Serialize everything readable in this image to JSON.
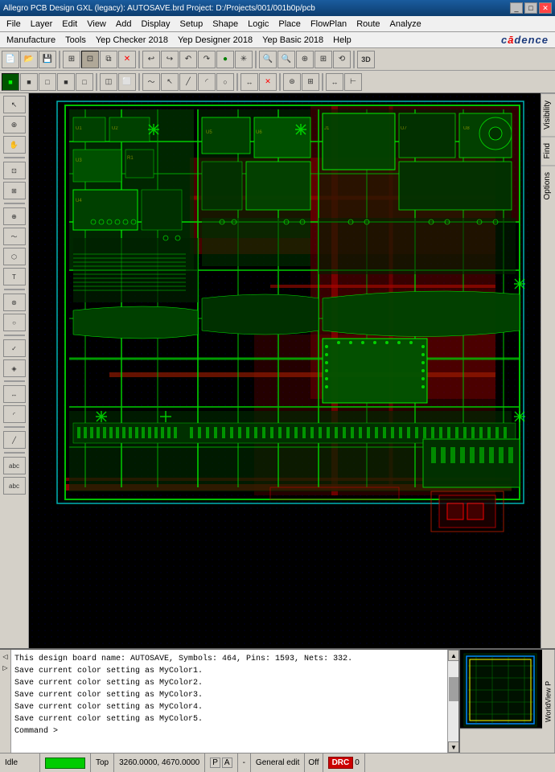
{
  "titleBar": {
    "text": "Allegro PCB Design GXL (legacy): AUTOSAVE.brd  Project: D:/Projects/001/001b0p/pcb",
    "minimizeLabel": "_",
    "maximizeLabel": "□",
    "closeLabel": "✕"
  },
  "menuBar1": {
    "items": [
      "File",
      "Layer",
      "Edit",
      "View",
      "Add",
      "Display",
      "Setup",
      "Shape",
      "Logic",
      "Place",
      "FlowPlan",
      "Route",
      "Analyze"
    ]
  },
  "menuBar2": {
    "items": [
      "Manufacture",
      "Tools",
      "Yep Checker 2018",
      "Yep Designer 2018",
      "Yep Basic 2018",
      "Help"
    ],
    "logo": "cadence"
  },
  "consoleLines": [
    "This design board name: AUTOSAVE, Symbols: 464, Pins: 1593, Nets: 332.",
    "Save current color setting as MyColor1.",
    "Save current color setting as MyColor2.",
    "Save current color setting as MyColor3.",
    "Save current color setting as MyColor4.",
    "Save current color setting as MyColor5.",
    "Command >"
  ],
  "statusBar": {
    "idle": "Idle",
    "layer": "Top",
    "coords": "3260.0000, 4670.0000",
    "coordUnit": "P",
    "coordMode": "A",
    "separator": "-",
    "mode": "General edit",
    "drcOff": "Off",
    "drc": "DRC",
    "count": "0"
  },
  "rightTabs": [
    "Visibility",
    "Find",
    "Options"
  ],
  "worldViewLabel": "WorldView P"
}
